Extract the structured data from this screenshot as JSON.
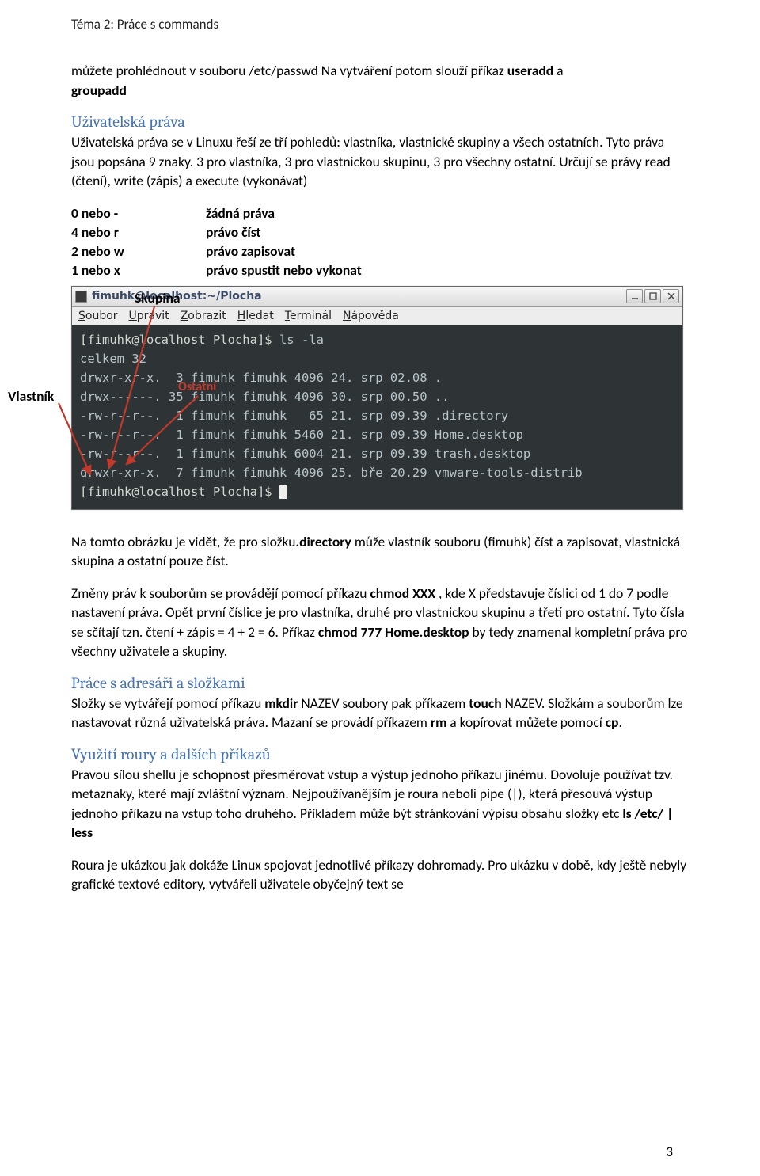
{
  "header": "Téma 2: Práce s commands",
  "intro": {
    "line1_a": "můžete prohlédnout v souboru /etc/passwd Na vytváření potom slouží příkaz ",
    "line1_b": "useradd",
    "line1_c": " a ",
    "line1_d": "groupadd"
  },
  "section1_title": "Uživatelská práva",
  "para1": "Uživatelská práva se v Linuxu řeší ze tří pohledů: vlastníka, vlastnické skupiny a všech ostatních. Tyto práva jsou popsána 9 znaky. 3 pro vlastníka, 3 pro vlastnickou skupinu, 3 pro všechny ostatní. Určují se právy read (čtení), write (zápis) a execute (vykonávat)",
  "rights": [
    {
      "k": "0 nebo -",
      "v": "žádná práva"
    },
    {
      "k": "4 nebo r",
      "v": "právo číst"
    },
    {
      "k": "2 nebo w",
      "v": "právo zapisovat"
    },
    {
      "k": "1 nebo x",
      "v": "právo spustit nebo vykonat"
    }
  ],
  "labels": {
    "vlastnik": "Vlastník",
    "skupina": "Skupina",
    "ostatni": "Ostatní"
  },
  "terminal": {
    "title": "fimuhk@localhost:~/Plocha",
    "menu": [
      "Soubor",
      "Upravit",
      "Zobrazit",
      "Hledat",
      "Terminál",
      "Nápověda"
    ],
    "prompt1": "[fimuhk@localhost Plocha]$ ",
    "cmd1": "ls -la",
    "lines": [
      "celkem 32",
      "drwxr-xr-x.  3 fimuhk fimuhk 4096 24. srp 02.08 .",
      "drwx------. 35 fimuhk fimuhk 4096 30. srp 00.50 ..",
      "-rw-r--r--.  1 fimuhk fimuhk   65 21. srp 09.39 .directory",
      "-rw-r--r--.  1 fimuhk fimuhk 5460 21. srp 09.39 Home.desktop",
      "-rw-r--r--.  1 fimuhk fimuhk 6004 21. srp 09.39 trash.desktop",
      "drwxr-xr-x.  7 fimuhk fimuhk 4096 25. bře 20.29 vmware-tools-distrib"
    ],
    "prompt2": "[fimuhk@localhost Plocha]$ "
  },
  "after_term": {
    "p1_a": "Na tomto obrázku je vidět, že pro složku",
    "p1_b": ".directory",
    "p1_c": " může vlastník souboru (fimuhk) číst a zapisovat, vlastnická skupina a ostatní pouze číst.",
    "p2_a": "Změny práv k souborům se provádějí pomocí příkazu ",
    "p2_b": "chmod XXX",
    "p2_c": " , kde X představuje číslici od 1 do 7 podle nastavení práva. Opět první číslice je pro vlastníka, druhé pro vlastnickou skupinu a třetí pro ostatní. Tyto čísla se sčítají tzn. čtení + zápis = 4 + 2 = 6. Příkaz ",
    "p2_d": "chmod 777 Home.desktop",
    "p2_e": " by tedy znamenal kompletní práva pro všechny uživatele a skupiny."
  },
  "section2_title": "Práce s adresáři a složkami",
  "section2": {
    "a": "Složky se vytvářejí pomocí příkazu ",
    "b": "mkdir",
    "c": " NAZEV soubory pak příkazem ",
    "d": "touch",
    "e": " NAZEV. Složkám a souborům lze nastavovat různá uživatelská práva. Mazaní se provádí příkazem ",
    "f": "rm",
    "g": " a kopírovat můžete pomocí ",
    "h": "cp",
    "i": "."
  },
  "section3_title": "Využití roury a dalších příkazů",
  "section3": {
    "p1_a": "Pravou sílou shellu je schopnost přesměrovat vstup a výstup jednoho příkazu jinému. Dovoluje používat tzv. metaznaky, které mají zvláštní význam. Nejpoužívanějším je roura neboli pipe (|), která přesouvá výstup jednoho příkazu na vstup toho druhého. Příkladem může být stránkování výpisu obsahu složky etc ",
    "p1_b": "ls /etc/ | less",
    "p2": "Roura je ukázkou jak dokáže Linux spojovat jednotlivé příkazy dohromady. Pro ukázku v době, kdy ještě nebyly grafické textové editory, vytvářeli uživatele obyčejný text se"
  },
  "page_num": "3"
}
